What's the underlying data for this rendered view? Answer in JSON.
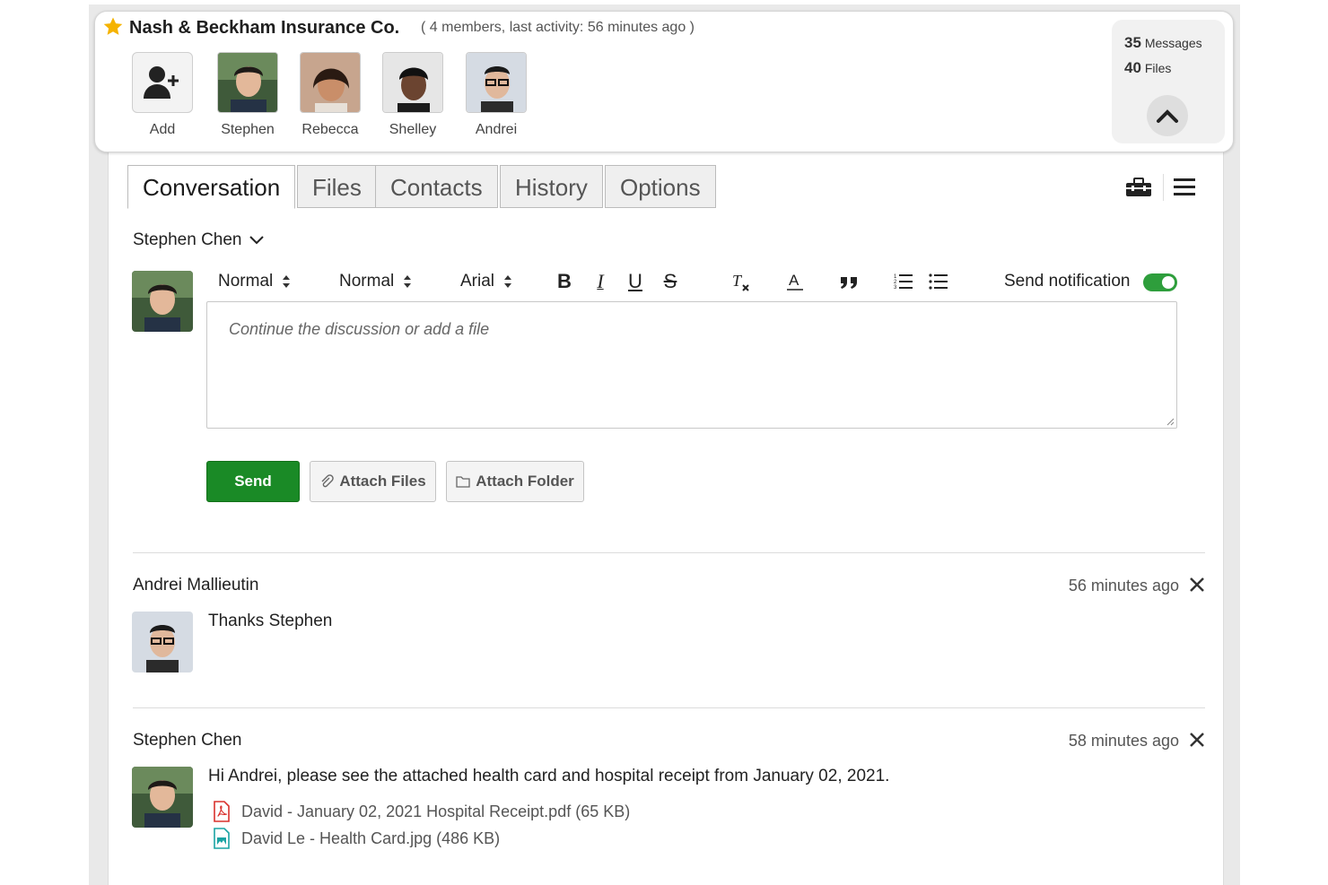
{
  "group": {
    "title": "Nash & Beckham Insurance Co.",
    "subtitle": "( 4 members, last activity: 56 minutes ago )",
    "add_label": "Add",
    "members": [
      {
        "name": "Stephen"
      },
      {
        "name": "Rebecca"
      },
      {
        "name": "Shelley"
      },
      {
        "name": "Andrei"
      }
    ],
    "stats": {
      "messages_count": "35",
      "messages_label": "Messages",
      "files_count": "40",
      "files_label": "Files"
    }
  },
  "tabs": [
    {
      "label": "Conversation",
      "active": true
    },
    {
      "label": "Files"
    },
    {
      "label": "Contacts"
    },
    {
      "label": "History"
    },
    {
      "label": "Options"
    }
  ],
  "composer": {
    "author": "Stephen Chen",
    "style_select": "Normal",
    "size_select": "Normal",
    "font_select": "Arial",
    "notify_label": "Send notification",
    "notify_on": true,
    "placeholder": "Continue the discussion or add a file",
    "send_label": "Send",
    "attach_files_label": "Attach Files",
    "attach_folder_label": "Attach Folder"
  },
  "messages": [
    {
      "author": "Andrei Mallieutin",
      "time": "56 minutes ago",
      "text": "Thanks Stephen",
      "attachments": []
    },
    {
      "author": "Stephen Chen",
      "time": "58 minutes ago",
      "text": "Hi Andrei, please see the attached health card and hospital receipt from January 02, 2021.",
      "attachments": [
        {
          "name": "David - January 02, 2021 Hospital Receipt.pdf (65 KB)",
          "icon": "pdf-file-icon"
        },
        {
          "name": "David Le - Health Card.jpg (486 KB)",
          "icon": "image-file-icon"
        }
      ]
    }
  ],
  "colors": {
    "accent_green": "#1a8a26",
    "star": "#f5b301",
    "pdf": "#d9302c",
    "image": "#1aa3a3"
  }
}
